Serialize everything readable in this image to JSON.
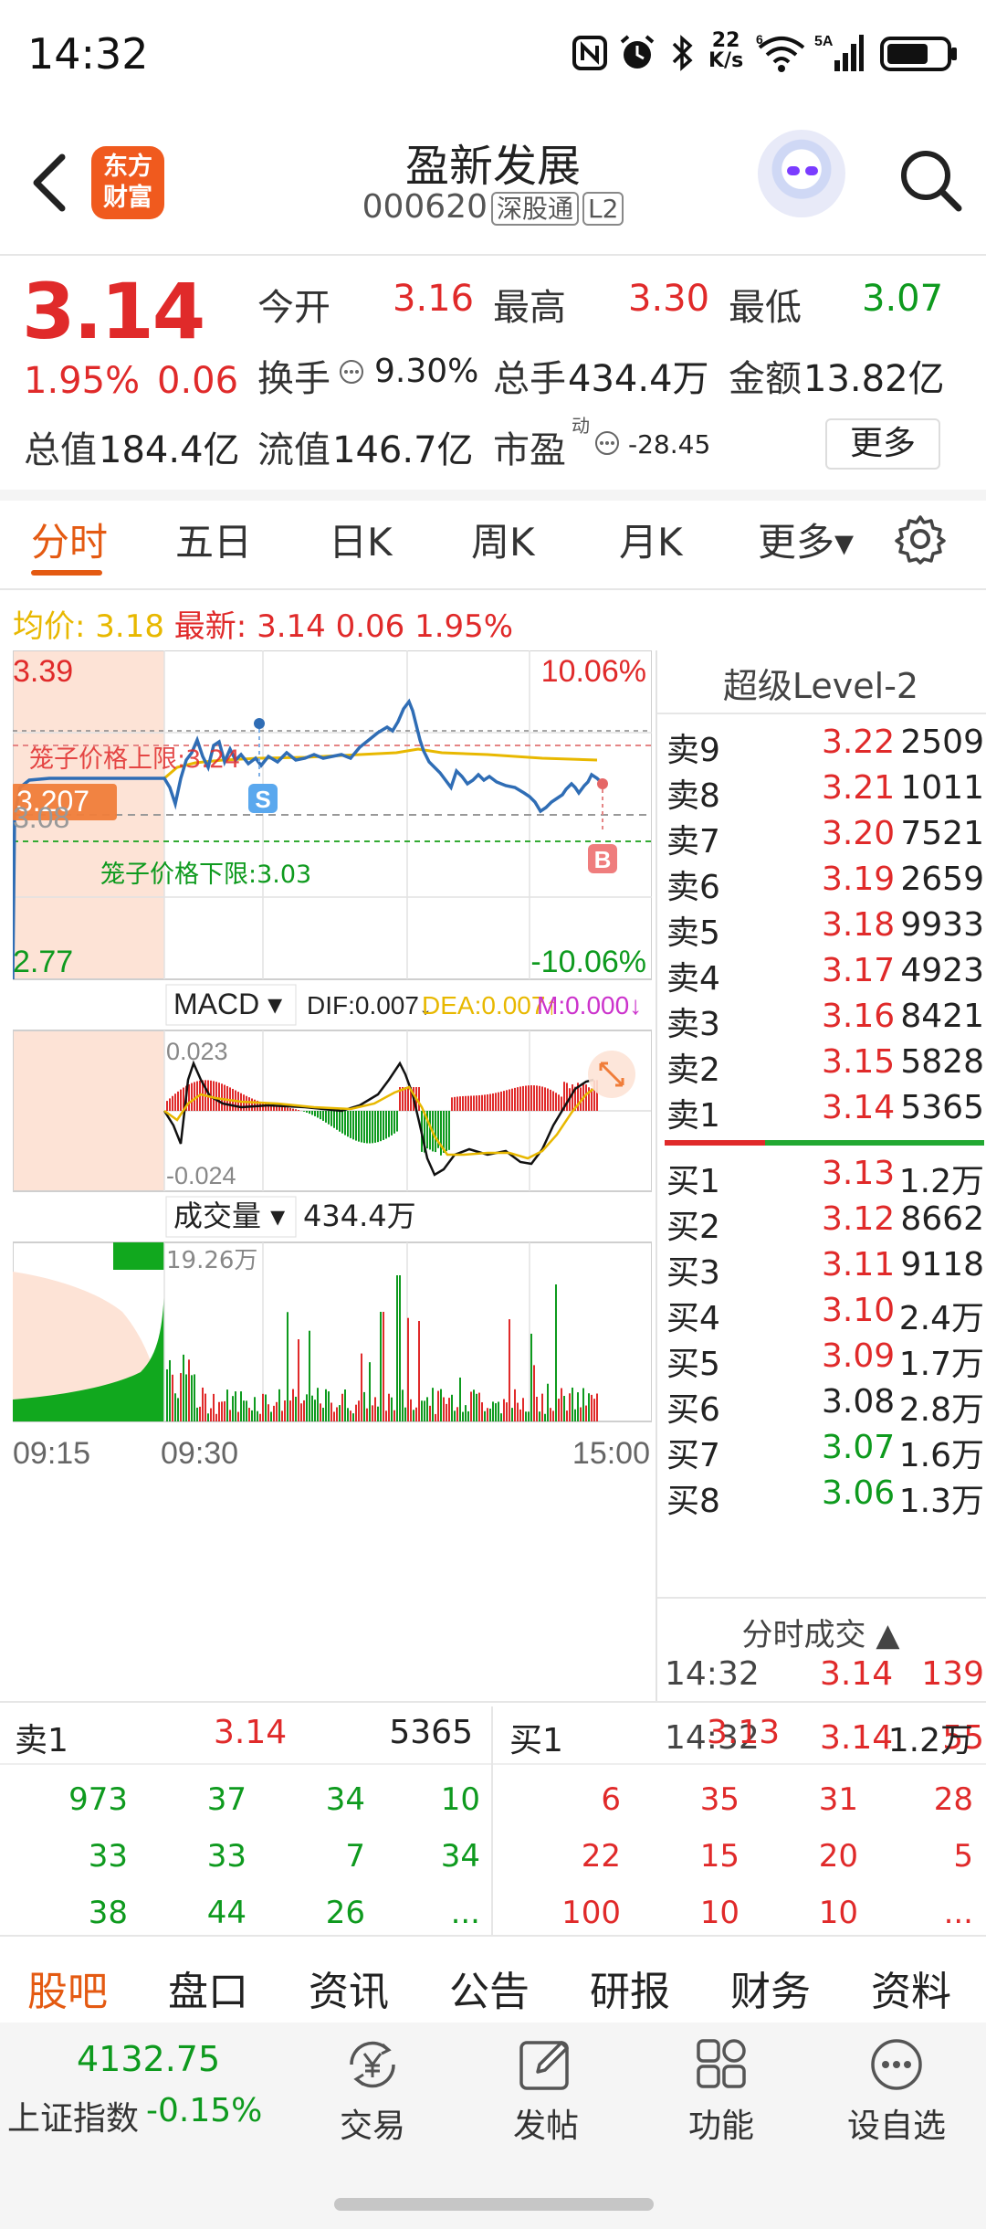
{
  "status_bar": {
    "time": "14:32",
    "net_speed": "22\nK/s",
    "signal_label": "5A"
  },
  "header": {
    "name": "盈新发展",
    "code": "000620",
    "tags": [
      "深股通",
      "L2"
    ],
    "logo_lines": [
      "东方",
      "财富"
    ]
  },
  "quote": {
    "price": "3.14",
    "pct_change": "1.95%",
    "abs_change": "0.06",
    "open_label": "今开",
    "open": "3.16",
    "high_label": "最高",
    "high": "3.30",
    "low_label": "最低",
    "low": "3.07",
    "turnover_label": "换手",
    "turnover": "9.30%",
    "volume_label": "总手",
    "volume": "434.4万",
    "amount_label": "金额",
    "amount": "13.82亿",
    "mktcap_label": "总值",
    "mktcap": "184.4亿",
    "float_label": "流值",
    "float": "146.7亿",
    "pe_label": "市盈",
    "pe_sup": "动",
    "pe": "-28.45",
    "more_label": "更多"
  },
  "tabs": [
    "分时",
    "五日",
    "日K",
    "周K",
    "月K",
    "更多▾"
  ],
  "avg_row": {
    "avg_label": "均价:",
    "avg": "3.18",
    "latest_label": "最新:",
    "latest": "3.14 0.06 1.95%"
  },
  "chart": {
    "y_top": "3.39",
    "y_bottom": "2.77",
    "pct_top": "10.06%",
    "pct_bottom": "-10.06%",
    "price_tag": "3.207",
    "mid_label": "3.08",
    "cage_upper": "笼子价格上限:3.24",
    "cage_lower": "笼子价格下限:3.03",
    "sell_marker": "S",
    "buy_marker": "B",
    "macd_label": "MACD ▾",
    "dif": "DIF:0.007↓",
    "dea": "DEA:0.007↑",
    "m": "M:0.000↓",
    "macd_top": "0.023",
    "macd_bottom": "-0.024",
    "vol_label": "成交量 ▾",
    "vol_total": "434.4万",
    "vol_max": "19.26万",
    "time_labels": [
      "09:15",
      "09:30",
      "15:00"
    ],
    "colors": {
      "price": "#2f6db5",
      "avg": "#e8b800",
      "up": "#e02a2a",
      "down": "#0e9a1e",
      "auction_bg": "#fde3d6"
    }
  },
  "order_book": {
    "title": "超级Level-2",
    "asks": [
      {
        "label": "卖9",
        "price": "3.22",
        "vol": "2509"
      },
      {
        "label": "卖8",
        "price": "3.21",
        "vol": "1011"
      },
      {
        "label": "卖7",
        "price": "3.20",
        "vol": "7521"
      },
      {
        "label": "卖6",
        "price": "3.19",
        "vol": "2659"
      },
      {
        "label": "卖5",
        "price": "3.18",
        "vol": "9933"
      },
      {
        "label": "卖4",
        "price": "3.17",
        "vol": "4923"
      },
      {
        "label": "卖3",
        "price": "3.16",
        "vol": "8421"
      },
      {
        "label": "卖2",
        "price": "3.15",
        "vol": "5828"
      },
      {
        "label": "卖1",
        "price": "3.14",
        "vol": "5365"
      }
    ],
    "bids": [
      {
        "label": "买1",
        "price": "3.13",
        "vol": "1.2万",
        "color": "red"
      },
      {
        "label": "买2",
        "price": "3.12",
        "vol": "8662",
        "color": "red"
      },
      {
        "label": "买3",
        "price": "3.11",
        "vol": "9118",
        "color": "red"
      },
      {
        "label": "买4",
        "price": "3.10",
        "vol": "2.4万",
        "color": "red"
      },
      {
        "label": "买5",
        "price": "3.09",
        "vol": "1.7万",
        "color": "red"
      },
      {
        "label": "买6",
        "price": "3.08",
        "vol": "2.8万",
        "color": "black"
      },
      {
        "label": "买7",
        "price": "3.07",
        "vol": "1.6万",
        "color": "green"
      },
      {
        "label": "买8",
        "price": "3.06",
        "vol": "1.3万",
        "color": "green"
      }
    ],
    "ticks_title": "分时成交 ▲",
    "ticks": [
      {
        "time": "14:32",
        "price": "3.14",
        "vol": "139"
      },
      {
        "time": "14:32",
        "price": "3.14",
        "vol": "55"
      }
    ]
  },
  "level1": {
    "sell": {
      "label": "卖1",
      "price": "3.14",
      "vol": "5365",
      "queue": [
        [
          "973",
          "37",
          "34",
          "10"
        ],
        [
          "33",
          "33",
          "7",
          "34"
        ],
        [
          "38",
          "44",
          "26",
          "..."
        ]
      ]
    },
    "buy": {
      "label": "买1",
      "price": "3.13",
      "vol": "1.2万",
      "queue": [
        [
          "6",
          "35",
          "31",
          "28"
        ],
        [
          "22",
          "15",
          "20",
          "5"
        ],
        [
          "100",
          "10",
          "10",
          "..."
        ]
      ]
    }
  },
  "bottom_tabs": [
    "股吧",
    "盘口",
    "资讯",
    "公告",
    "研报",
    "财务",
    "资料"
  ],
  "bottom_bar": {
    "index_value": "4132.75",
    "index_name": "上证指数",
    "index_change": "-0.15%",
    "buttons": [
      {
        "label": "交易",
        "icon": "yen-cycle-icon"
      },
      {
        "label": "发帖",
        "icon": "edit-icon"
      },
      {
        "label": "功能",
        "icon": "grid-icon"
      },
      {
        "label": "设自选",
        "icon": "more-dots-icon"
      }
    ]
  }
}
